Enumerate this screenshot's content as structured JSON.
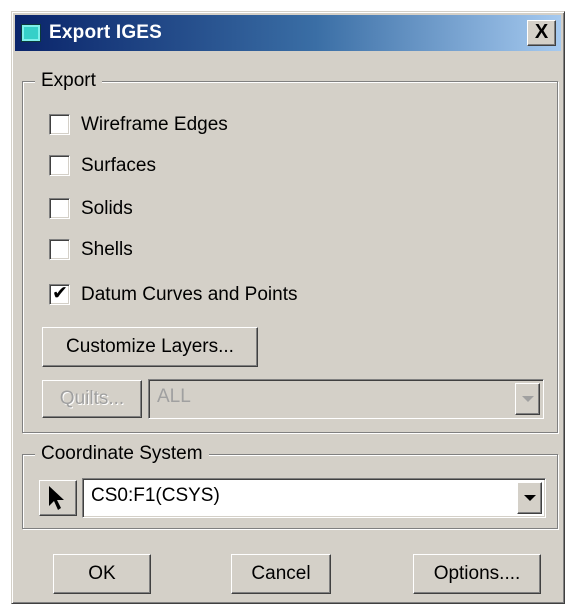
{
  "window": {
    "title": "Export IGES",
    "icon": "app-icon",
    "close_label": "X"
  },
  "export_group": {
    "label": "Export",
    "checkboxes": [
      {
        "label": "Wireframe Edges",
        "checked": false
      },
      {
        "label": "Surfaces",
        "checked": false
      },
      {
        "label": "Solids",
        "checked": false
      },
      {
        "label": "Shells",
        "checked": false
      },
      {
        "label": "Datum Curves and Points",
        "checked": true
      }
    ],
    "check_mark": "✔",
    "customize_layers_label": "Customize Layers...",
    "quilts_label": "Quilts...",
    "quilts_value": "ALL"
  },
  "coord_group": {
    "label": "Coordinate System",
    "select_icon": "cursor-arrow-icon",
    "value": "CS0:F1(CSYS)"
  },
  "buttons": {
    "ok": "OK",
    "cancel": "Cancel",
    "options": "Options...."
  }
}
